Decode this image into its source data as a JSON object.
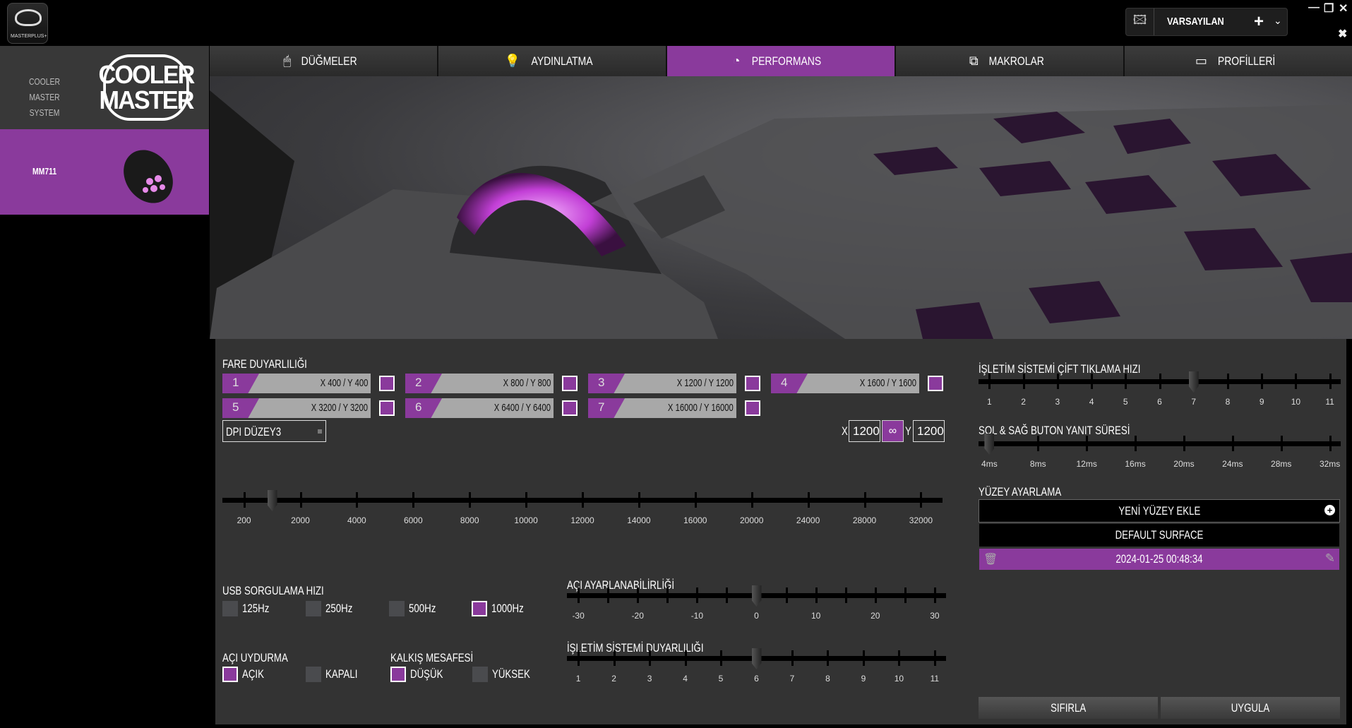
{
  "app": {
    "logo_text": "MASTERPLUS+"
  },
  "profile": {
    "name": "VARSAYILAN",
    "add": "+",
    "dropdown": "⌄"
  },
  "window": {
    "minimize": "—",
    "restore": "❐",
    "close": "✕",
    "settings": "✖"
  },
  "sidebar": {
    "brand_label_1": "COOLER MASTER",
    "brand_label_2": "SYSTEM",
    "logo_line1": "COOLER",
    "logo_line2": "MASTER",
    "device": "MM711"
  },
  "tabs": [
    {
      "label": "DÜĞMELER",
      "icon": "🖱"
    },
    {
      "label": "AYDINLATMA",
      "icon": "💡"
    },
    {
      "label": "PERFORMANS",
      "icon": "◔"
    },
    {
      "label": "MAKROLAR",
      "icon": "⧉"
    },
    {
      "label": "PROFİLLERİ",
      "icon": "▭"
    }
  ],
  "sensitivity": {
    "title": "FARE DUYARLILIĞI",
    "levels": [
      {
        "n": "1",
        "v": "X 400 / Y 400",
        "on": true
      },
      {
        "n": "2",
        "v": "X 800 / Y 800",
        "on": true
      },
      {
        "n": "3",
        "v": "X 1200 / Y 1200",
        "on": true
      },
      {
        "n": "4",
        "v": "X 1600 / Y 1600",
        "on": true
      },
      {
        "n": "5",
        "v": "X 3200 / Y 3200",
        "on": true
      },
      {
        "n": "6",
        "v": "X 6400 / Y 6400",
        "on": true
      },
      {
        "n": "7",
        "v": "X 16000 / Y 16000",
        "on": true
      }
    ],
    "selected_level": "DPI DÜZEY3",
    "x_label": "X",
    "x_value": "1200",
    "y_label": "Y",
    "y_value": "1200",
    "slider": {
      "labels": [
        "200",
        "2000",
        "4000",
        "6000",
        "8000",
        "10000",
        "12000",
        "14000",
        "16000",
        "20000",
        "24000",
        "28000",
        "32000"
      ],
      "value_index": 0.5
    }
  },
  "usb": {
    "title": "USB SORGULAMA HIZI",
    "options": [
      {
        "label": "125Hz",
        "on": false
      },
      {
        "label": "250Hz",
        "on": false
      },
      {
        "label": "500Hz",
        "on": false
      },
      {
        "label": "1000Hz",
        "on": true
      }
    ]
  },
  "angle_snap": {
    "title": "AÇI UYDURMA",
    "options": [
      {
        "label": "AÇIK",
        "on": true
      },
      {
        "label": "KAPALI",
        "on": false
      }
    ]
  },
  "lift_off": {
    "title": "KALKIŞ MESAFESİ",
    "options": [
      {
        "label": "DÜŞÜK",
        "on": true
      },
      {
        "label": "YÜKSEK",
        "on": false
      }
    ]
  },
  "angle_tuning": {
    "title": "AÇI AYARLANABİLİRLİĞİ",
    "labels": [
      "-30",
      "-20",
      "-10",
      "0",
      "10",
      "20",
      "30"
    ],
    "ticks": 13,
    "value": 0
  },
  "os_sensitivity": {
    "title": "İŞLETİM SİSTEMİ DUYARLILIĞI",
    "labels": [
      "1",
      "2",
      "3",
      "4",
      "5",
      "6",
      "7",
      "8",
      "9",
      "10",
      "11"
    ],
    "value": 6
  },
  "double_click": {
    "title": "İŞLETİM SİSTEMİ ÇİFT TIKLAMA HIZI",
    "labels": [
      "1",
      "2",
      "3",
      "4",
      "5",
      "6",
      "7",
      "8",
      "9",
      "10",
      "11"
    ],
    "value": 7
  },
  "response": {
    "title": "SOL & SAĞ BUTON YANIT SÜRESİ",
    "labels": [
      "4ms",
      "8ms",
      "12ms",
      "16ms",
      "20ms",
      "24ms",
      "28ms",
      "32ms"
    ],
    "value": "4ms"
  },
  "surface": {
    "title": "YÜZEY AYARLAMA",
    "add": "YENİ YÜZEY EKLE",
    "default": "DEFAULT SURFACE",
    "custom": "2024-01-25 00:48:34"
  },
  "actions": {
    "reset": "SIFIRLA",
    "apply": "UYGULA"
  },
  "colors": {
    "accent": "#8a3a9c",
    "panel": "#333333"
  }
}
